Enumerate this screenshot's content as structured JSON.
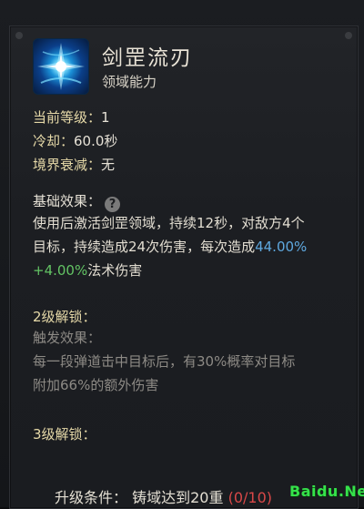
{
  "skill": {
    "name": "剑罡流刃",
    "type": "领域能力",
    "icon": "blue-sword-aura-icon"
  },
  "stats": {
    "level_label": "当前等级：",
    "level_value": "1",
    "cooldown_label": "冷却：",
    "cooldown_value": "60.0秒",
    "decay_label": "境界衰减：",
    "decay_value": "无"
  },
  "effect": {
    "heading": "基础效果：",
    "help_glyph": "?",
    "line1": "使用后激活剑罡领域，持续12秒，对敌方4个",
    "line2_prefix": "目标，持续造成24次伤害，每次造成",
    "line2_blue": "44.00%",
    "line3_green": "+4.00%",
    "line3_suffix": "法术伤害"
  },
  "unlock2": {
    "heading": "2级解锁：",
    "sub": "触发效果：",
    "line1": "每一段弹道击中目标后，有30%概率对目标",
    "line2": "附加66%的额外伤害"
  },
  "unlock3": {
    "heading": "3级解锁："
  },
  "footer": {
    "label": "升级条件：",
    "condition": "铸域达到20重",
    "progress_open": "(0/",
    "progress_rest": "10)"
  },
  "watermark": "Baidu.Net",
  "colors": {
    "blue_value": "#5fa9e0",
    "green_value": "#63c464",
    "red_progress": "#d94848",
    "watermark": "#35e24a"
  }
}
